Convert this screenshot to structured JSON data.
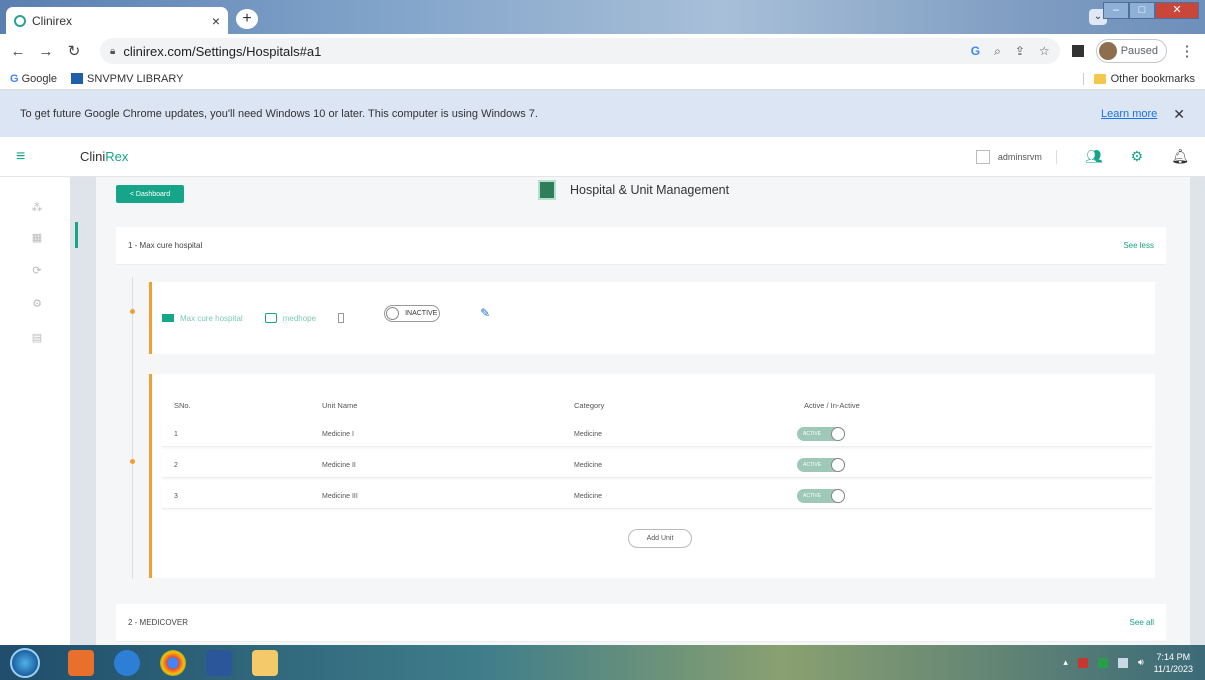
{
  "browser": {
    "tab_title": "Clinirex",
    "tab_close": "×",
    "new_tab": "+",
    "url": "clinirex.com/Settings/Hospitals#a1",
    "profile_status": "Paused",
    "bookmarks": [
      "Google",
      "SNVPMV LIBRARY"
    ],
    "other_bookmarks": "Other bookmarks",
    "info_message": "To get future Google Chrome updates, you'll need Windows 10 or later. This computer is using Windows 7.",
    "learn_more": "Learn more",
    "info_close": "✕"
  },
  "app": {
    "brand_prefix": "Clini",
    "brand_suffix": "Rex",
    "username": "adminsrvm",
    "dashboard_button": "< Dashboard",
    "page_title": "Hospital & Unit Management",
    "accent_color": "#17a589",
    "highlight_color": "#f0a030"
  },
  "hospitals": [
    {
      "title": "1 - Max cure hospital",
      "toggle_link": "See less",
      "name": "Max cure hospital",
      "code": "medhope",
      "status": "INACTIVE",
      "columns": [
        "SNo.",
        "Unit Name",
        "Category",
        "Active / In-Active"
      ],
      "units": [
        {
          "sno": "1",
          "name": "Medicine I",
          "category": "Medicine",
          "status": "ACTIVE"
        },
        {
          "sno": "2",
          "name": "Medicine II",
          "category": "Medicine",
          "status": "ACTIVE"
        },
        {
          "sno": "3",
          "name": "Medicine III",
          "category": "Medicine",
          "status": "ACTIVE"
        }
      ],
      "add_unit": "Add Unit"
    },
    {
      "title": "2 - MEDICOVER",
      "toggle_link": "See all"
    }
  ],
  "taskbar": {
    "time": "7:14 PM",
    "date": "11/1/2023"
  }
}
